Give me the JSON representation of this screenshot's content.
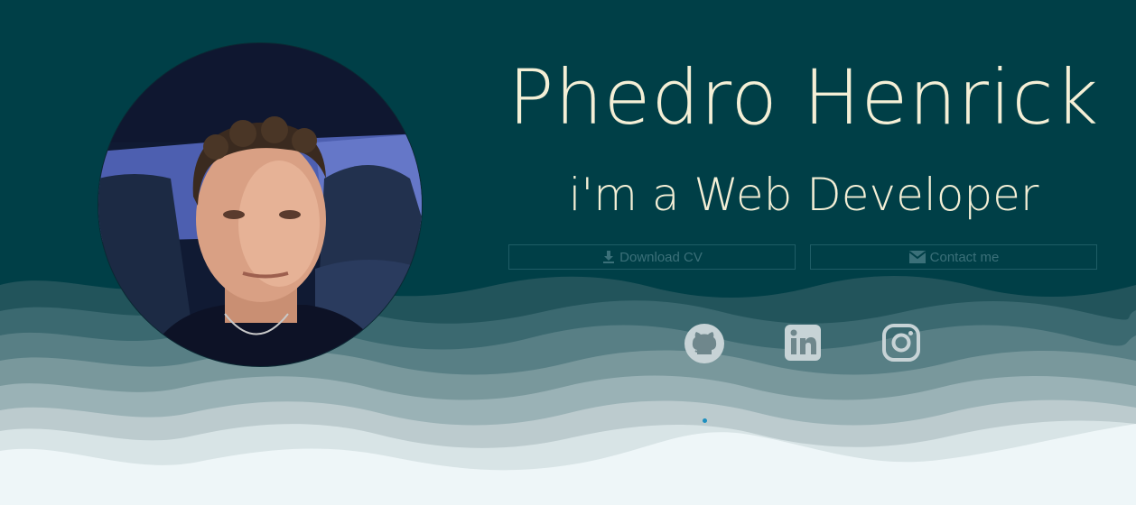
{
  "profile": {
    "name": "Phedro Henrick",
    "role": "i'm a Web Developer",
    "photo_description": "avatar"
  },
  "buttons": {
    "download_cv": {
      "label": "Download CV",
      "icon": "download-icon"
    },
    "contact": {
      "label": "Contact me",
      "icon": "mail-icon"
    }
  },
  "social": [
    {
      "name": "github",
      "icon": "github-icon"
    },
    {
      "name": "linkedin",
      "icon": "linkedin-icon"
    },
    {
      "name": "instagram",
      "icon": "instagram-icon"
    }
  ],
  "colors": {
    "background": "#003f47",
    "text": "#f4efd6",
    "button_border": "#1f5d66",
    "button_text": "#3b7079",
    "icon": "#c7d3d6",
    "wave_lightest": "#eef6f8"
  }
}
